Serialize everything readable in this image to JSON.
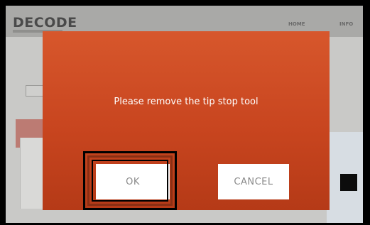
{
  "app": {
    "brand": "DECODE",
    "nav": [
      "HOME",
      "INFO"
    ]
  },
  "dialog": {
    "message": "Please remove the tip stop tool",
    "ok_label": "OK",
    "cancel_label": "CANCEL"
  },
  "colors": {
    "dialog_bg": "#c8451f",
    "button_bg": "#ffffff",
    "button_text": "#8a8a8a",
    "highlight": "#000000"
  }
}
